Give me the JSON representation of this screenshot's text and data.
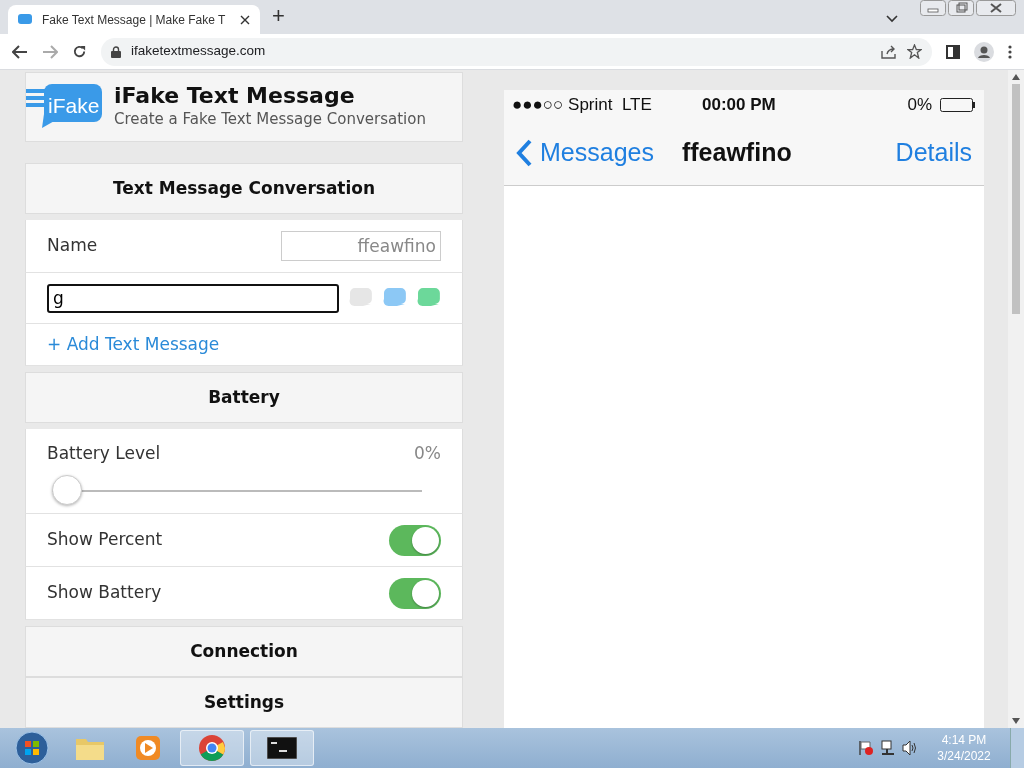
{
  "browser": {
    "tab_title": "Fake Text Message | Make Fake T",
    "url": "ifaketextmessage.com",
    "new_tab": "+"
  },
  "header": {
    "logo_text": "iFake",
    "title": "iFake Text Message",
    "subtitle": "Create a Fake Text Message Conversation"
  },
  "conversation": {
    "heading": "Text Message Conversation",
    "name_label": "Name",
    "name_value": "ffeawfino",
    "message_value": "g",
    "bubble_colors": [
      {
        "color": "#e6e6e6"
      },
      {
        "color": "#8cc8f5"
      },
      {
        "color": "#6cd89a"
      }
    ],
    "add_link": "+ Add Text Message"
  },
  "battery": {
    "heading": "Battery",
    "level_label": "Battery Level",
    "reading": "0%",
    "level": 0,
    "toggles": [
      {
        "label": "Show Percent",
        "on": true
      },
      {
        "label": "Show Battery",
        "on": true
      }
    ]
  },
  "more_sections": [
    {
      "heading": "Connection"
    },
    {
      "heading": "Settings"
    }
  ],
  "phone": {
    "carrier": "●●●○○ Sprint  LTE",
    "time": "00:00 PM",
    "battery_text": "0%",
    "back": "Messages",
    "contact": "ffeawfino",
    "details": "Details"
  },
  "taskbar": {
    "time": "4:14 PM",
    "date": "3/24/2022"
  }
}
